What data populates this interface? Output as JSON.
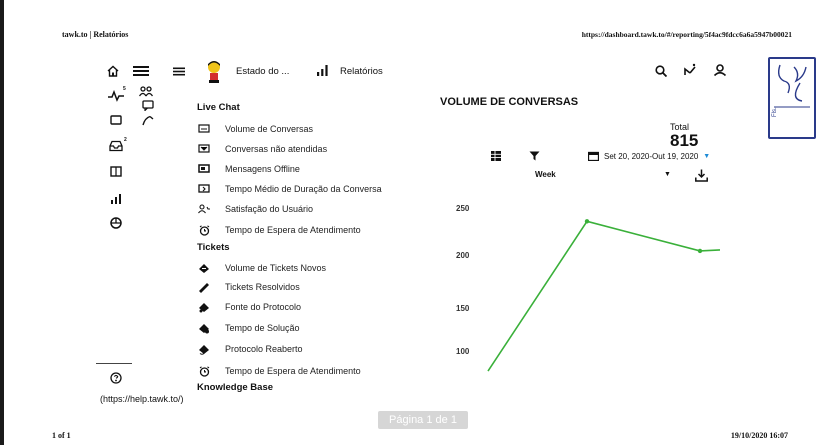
{
  "print_header": {
    "title": "tawk.to | Relatórios",
    "url": "https://dashboard.tawk.to/#/reporting/5f4ac9fdcc6a6a5947b00021"
  },
  "print_footer": {
    "page_count": "1 of 1",
    "timestamp": "19/10/2020 16:07"
  },
  "pager": {
    "label": "Página 1 de 1"
  },
  "topbar": {
    "property_name": "Estado do ...",
    "section_name": "Relatórios",
    "icons": [
      "home-icon",
      "menu-icon",
      "menu-icon",
      "avatar",
      "bar-chart-icon",
      "search-icon",
      "notifications-icon",
      "user-icon"
    ]
  },
  "rail": {
    "icons": [
      "activity-icon",
      "people-icon",
      "chat-icon",
      "monitor-icon",
      "inbox-icon",
      "grid-icon",
      "bar-chart-icon",
      "cube-icon",
      "help-icon"
    ],
    "badges": {
      "activity": "5",
      "inbox": "2"
    }
  },
  "menu": {
    "live_chat": {
      "heading": "Live Chat",
      "items": [
        "Volume de Conversas",
        "Conversas não atendidas",
        "Mensagens Offline",
        "Tempo Médio de Duração da Conversa",
        "Satisfação do Usuário",
        "Tempo de Espera de Atendimento"
      ]
    },
    "tickets": {
      "heading": "Tickets",
      "items": [
        "Volume de Tickets Novos",
        "Tickets Resolvidos",
        "Fonte do Protocolo",
        "Tempo de Solução",
        "Protocolo Reaberto",
        "Tempo de Espera de Atendimento"
      ]
    },
    "knowledge_base": {
      "heading": "Knowledge Base"
    }
  },
  "help_link": "(https://help.tawk.to/)",
  "report": {
    "title": "VOLUME DE CONVERSAS",
    "total_label": "Total",
    "total_value": "815",
    "date_range": "Set 20, 2020-Out 19, 2020",
    "granularity": "Week",
    "accent_color": "#3ab03a",
    "link_color": "#1e8bd6"
  },
  "chart_data": {
    "type": "line",
    "title": "VOLUME DE CONVERSAS",
    "xlabel": "",
    "ylabel": "",
    "y_ticks": [
      250,
      200,
      150,
      100
    ],
    "ylim": [
      75,
      260
    ],
    "x": [
      0,
      1,
      2,
      3
    ],
    "series": [
      {
        "values": [
          79,
          236,
          205,
          206
        ]
      }
    ],
    "grid": false,
    "legend": "none"
  },
  "stamp": {
    "text": "Fls."
  }
}
